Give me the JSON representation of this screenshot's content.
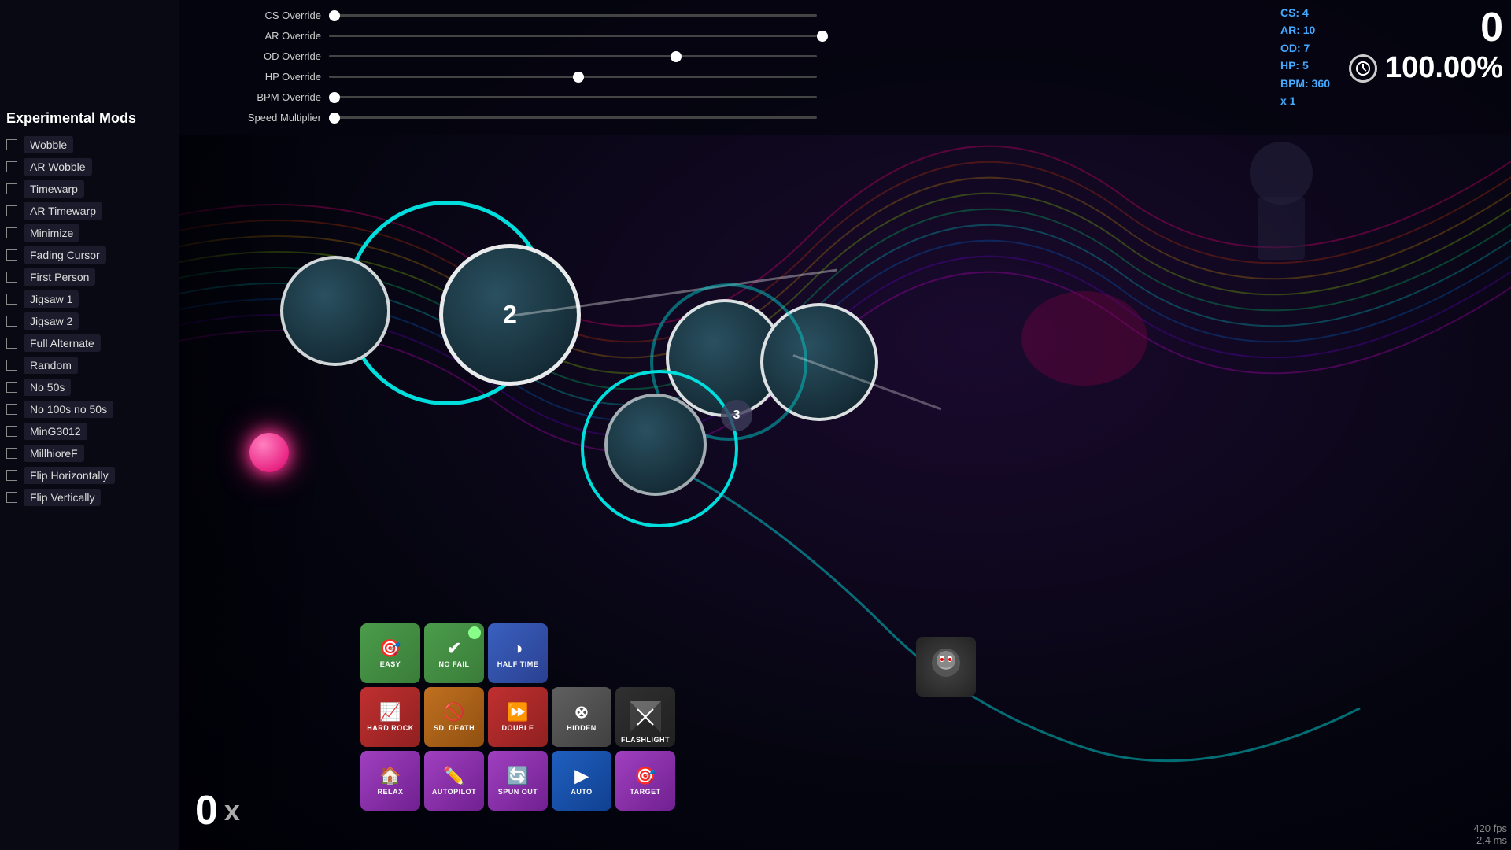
{
  "sidebar": {
    "title": "Experimental Mods",
    "mods": [
      {
        "id": "wobble",
        "label": "Wobble",
        "checked": false
      },
      {
        "id": "ar-wobble",
        "label": "AR Wobble",
        "checked": false
      },
      {
        "id": "timewarp",
        "label": "Timewarp",
        "checked": false
      },
      {
        "id": "ar-timewarp",
        "label": "AR Timewarp",
        "checked": false
      },
      {
        "id": "minimize",
        "label": "Minimize",
        "checked": false
      },
      {
        "id": "fading-cursor",
        "label": "Fading Cursor",
        "checked": false
      },
      {
        "id": "first-person",
        "label": "First Person",
        "checked": false
      },
      {
        "id": "jigsaw1",
        "label": "Jigsaw 1",
        "checked": false
      },
      {
        "id": "jigsaw2",
        "label": "Jigsaw 2",
        "checked": false
      },
      {
        "id": "full-alternate",
        "label": "Full Alternate",
        "checked": false
      },
      {
        "id": "random",
        "label": "Random",
        "checked": false
      },
      {
        "id": "no-50s",
        "label": "No 50s",
        "checked": false
      },
      {
        "id": "no-100s-50s",
        "label": "No 100s no 50s",
        "checked": false
      },
      {
        "id": "ming3012",
        "label": "MinG3012",
        "checked": false
      },
      {
        "id": "millhioref",
        "label": "MillhioreF",
        "checked": false
      },
      {
        "id": "flip-h",
        "label": "Flip Horizontally",
        "checked": false
      },
      {
        "id": "flip-v",
        "label": "Flip Vertically",
        "checked": false
      }
    ]
  },
  "sliders": [
    {
      "label": "CS Override",
      "value": "CS: 4",
      "position": 0
    },
    {
      "label": "AR Override",
      "value": "AR: 10",
      "position": 1
    },
    {
      "label": "OD Override",
      "value": "OD: 7",
      "position": 0.7
    },
    {
      "label": "HP Override",
      "value": "HP: 5",
      "position": 0.5
    },
    {
      "label": "BPM Override",
      "value": "BPM: 360",
      "position": 0
    },
    {
      "label": "Speed Multiplier",
      "value": "x 1",
      "position": 0
    }
  ],
  "score": {
    "main": "0",
    "accuracy": "100.00%",
    "bottom_score": "0",
    "multiplier": "x"
  },
  "fps": {
    "fps": "420 fps",
    "ms": "2.4 ms"
  },
  "mod_buttons": {
    "row1": [
      {
        "id": "easy",
        "label": "EASY",
        "color": "#5cb85c",
        "icon": "🎯"
      },
      {
        "id": "no-fail",
        "label": "NO FAIL",
        "color": "#5cb85c",
        "icon": "✅"
      },
      {
        "id": "half-time",
        "label": "HALF TIME",
        "color": "#5680d0",
        "icon": "🌓"
      }
    ],
    "row2": [
      {
        "id": "hard-rock",
        "label": "HARD ROCK",
        "color": "#d04444",
        "icon": "📈"
      },
      {
        "id": "sudden-death",
        "label": "SD. DEATH",
        "color": "#d07020",
        "icon": "🚫"
      },
      {
        "id": "double-time",
        "label": "DOUBLE",
        "color": "#d04444",
        "icon": "⏩"
      },
      {
        "id": "hidden",
        "label": "HIDDEN",
        "color": "#888",
        "icon": "⊗"
      },
      {
        "id": "flashlight",
        "label": "FLASHLIGHT",
        "color": "#333",
        "icon": "✦"
      }
    ],
    "row3": [
      {
        "id": "relax",
        "label": "RELAX",
        "color": "#c050d0",
        "icon": "🏠"
      },
      {
        "id": "autopilot",
        "label": "AUTOPILOT",
        "color": "#c050d0",
        "icon": "✏️"
      },
      {
        "id": "spun-out",
        "label": "SPUN OUT",
        "color": "#c050d0",
        "icon": "🔄"
      },
      {
        "id": "auto",
        "label": "AUTO",
        "color": "#4080d0",
        "icon": "▶"
      },
      {
        "id": "target",
        "label": "TARGET",
        "color": "#c050d0",
        "icon": "🎯"
      }
    ]
  }
}
